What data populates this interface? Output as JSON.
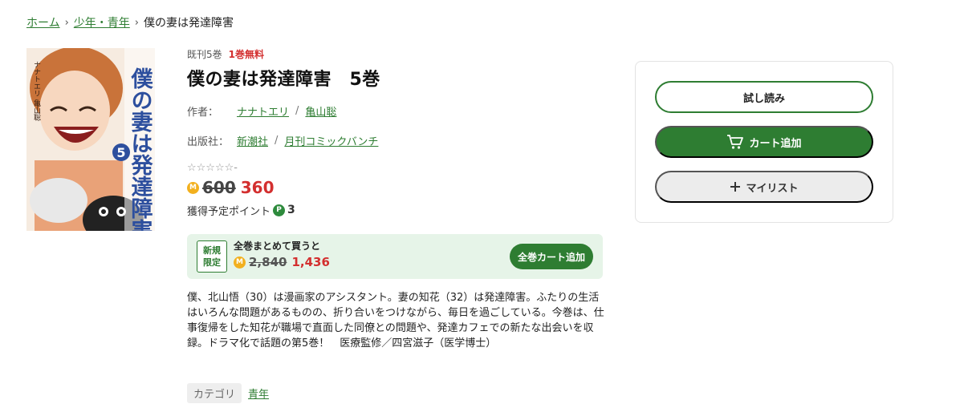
{
  "breadcrumb": {
    "home": "ホーム",
    "category": "少年・青年",
    "current": "僕の妻は発達障害"
  },
  "book": {
    "published_count": "既刊5巻",
    "free_note": "1巻無料",
    "title": "僕の妻は発達障害　5巻",
    "author_label": "作者：",
    "authors": [
      "ナナトエリ",
      "亀山聡"
    ],
    "publisher_label": "出版社：",
    "publishers": [
      "新潮社",
      "月刊コミックバンチ"
    ],
    "rating_stars": "☆☆☆☆☆",
    "rating_value": "-",
    "coin_icon": "M",
    "original_price": "600",
    "sale_price": "360",
    "points_label": "獲得予定ポイント",
    "points_icon": "P",
    "points_value": "3"
  },
  "bundle": {
    "badge_line1": "新規",
    "badge_line2": "限定",
    "label": "全巻まとめて買うと",
    "original_price": "2,840",
    "sale_price": "1,436",
    "button_label": "全巻カート追加"
  },
  "description": "僕、北山悟（30）は漫画家のアシスタント。妻の知花（32）は発達障害。ふたりの生活はいろんな問題があるものの、折り合いをつけながら、毎日を過ごしている。今巻は、仕事復帰をした知花が職場で直面した同僚との問題や、発達カフェでの新たな出会いを収録。ドラマ化で話題の第5巻！　医療監修／四宮滋子（医学博士）",
  "category": {
    "label": "カテゴリ",
    "value": "青年"
  },
  "actions": {
    "trial_label": "試し読み",
    "cart_label": "カート追加",
    "mylist_label": "マイリスト"
  },
  "cover_text": {
    "title_vertical": "僕の妻は発達障害",
    "volume": "5",
    "authors_vertical": "ナナトエリ 亀山聡"
  },
  "colors": {
    "accent_green": "#2e7d32",
    "price_red": "#d32f2f",
    "bundle_bg": "#e6f4e8"
  }
}
